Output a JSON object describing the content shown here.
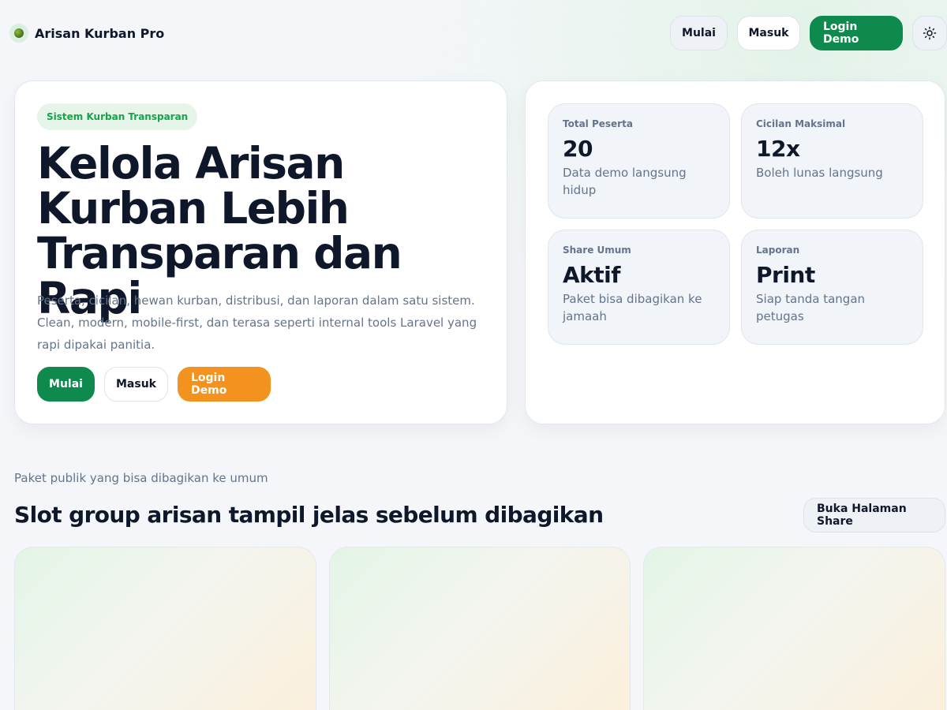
{
  "brand": {
    "name": "Arisan Kurban Pro"
  },
  "nav": {
    "mulai": "Mulai",
    "masuk": "Masuk",
    "login_demo": "Login Demo",
    "theme_icon": "sun-icon"
  },
  "hero": {
    "badge": "Sistem Kurban Transparan",
    "title": "Kelola Arisan Kurban Lebih Transparan dan Rapi",
    "description": "Peserta, cicilan, hewan kurban, distribusi, dan laporan dalam satu sistem. Clean, modern, mobile-first, dan terasa seperti internal tools Laravel yang rapi dipakai panitia.",
    "mulai": "Mulai",
    "masuk": "Masuk",
    "login_demo": "Login Demo"
  },
  "stats": [
    {
      "label": "Total Peserta",
      "value": "20",
      "desc": "Data demo langsung hidup"
    },
    {
      "label": "Cicilan Maksimal",
      "value": "12x",
      "desc": "Boleh lunas langsung"
    },
    {
      "label": "Share Umum",
      "value": "Aktif",
      "desc": "Paket bisa dibagikan ke jamaah"
    },
    {
      "label": "Laporan",
      "value": "Print",
      "desc": "Siap tanda tangan petugas"
    }
  ],
  "section": {
    "kicker": "Paket publik yang bisa dibagikan ke umum",
    "title": "Slot group arisan tampil jelas sebelum dibagikan",
    "share_button": "Buka Halaman Share"
  },
  "colors": {
    "primary_green": "#0f8a4f",
    "accent_orange": "#f3921f",
    "badge_text": "#16a34a"
  }
}
